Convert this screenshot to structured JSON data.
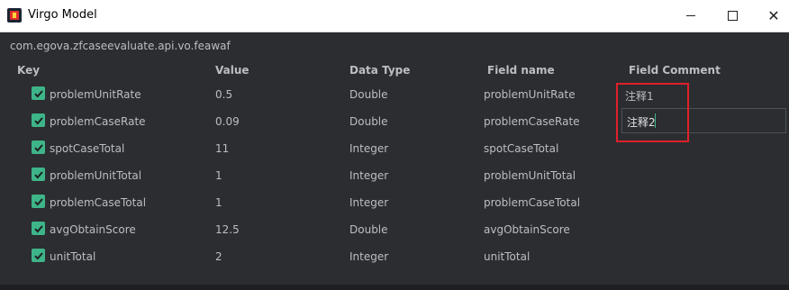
{
  "window": {
    "title": "Virgo Model",
    "controls": {
      "minimize": "minimize",
      "maximize": "maximize",
      "close": "✕"
    }
  },
  "package_path": "com.egova.zfcaseevaluate.api.vo.feawaf",
  "table": {
    "columns": [
      "Key",
      "Value",
      "Data Type",
      "Field name",
      "Field Comment"
    ],
    "rows": [
      {
        "checked": true,
        "key": "problemUnitRate",
        "value": "0.5",
        "type": "Double",
        "field": "problemUnitRate",
        "comment": "注释1"
      },
      {
        "checked": true,
        "key": "problemCaseRate",
        "value": "0.09",
        "type": "Double",
        "field": "problemCaseRate",
        "comment": "注释2"
      },
      {
        "checked": true,
        "key": "spotCaseTotal",
        "value": "11",
        "type": "Integer",
        "field": "spotCaseTotal",
        "comment": ""
      },
      {
        "checked": true,
        "key": "problemUnitTotal",
        "value": "1",
        "type": "Integer",
        "field": "problemUnitTotal",
        "comment": ""
      },
      {
        "checked": true,
        "key": "problemCaseTotal",
        "value": "1",
        "type": "Integer",
        "field": "problemCaseTotal",
        "comment": ""
      },
      {
        "checked": true,
        "key": "avgObtainScore",
        "value": "12.5",
        "type": "Double",
        "field": "avgObtainScore",
        "comment": ""
      },
      {
        "checked": true,
        "key": "unitTotal",
        "value": "2",
        "type": "Integer",
        "field": "unitTotal",
        "comment": ""
      }
    ]
  },
  "colors": {
    "background": "#2b2d30",
    "checkbox": "#3eb489",
    "highlight": "#e0202a",
    "text": "#bcbec4"
  }
}
